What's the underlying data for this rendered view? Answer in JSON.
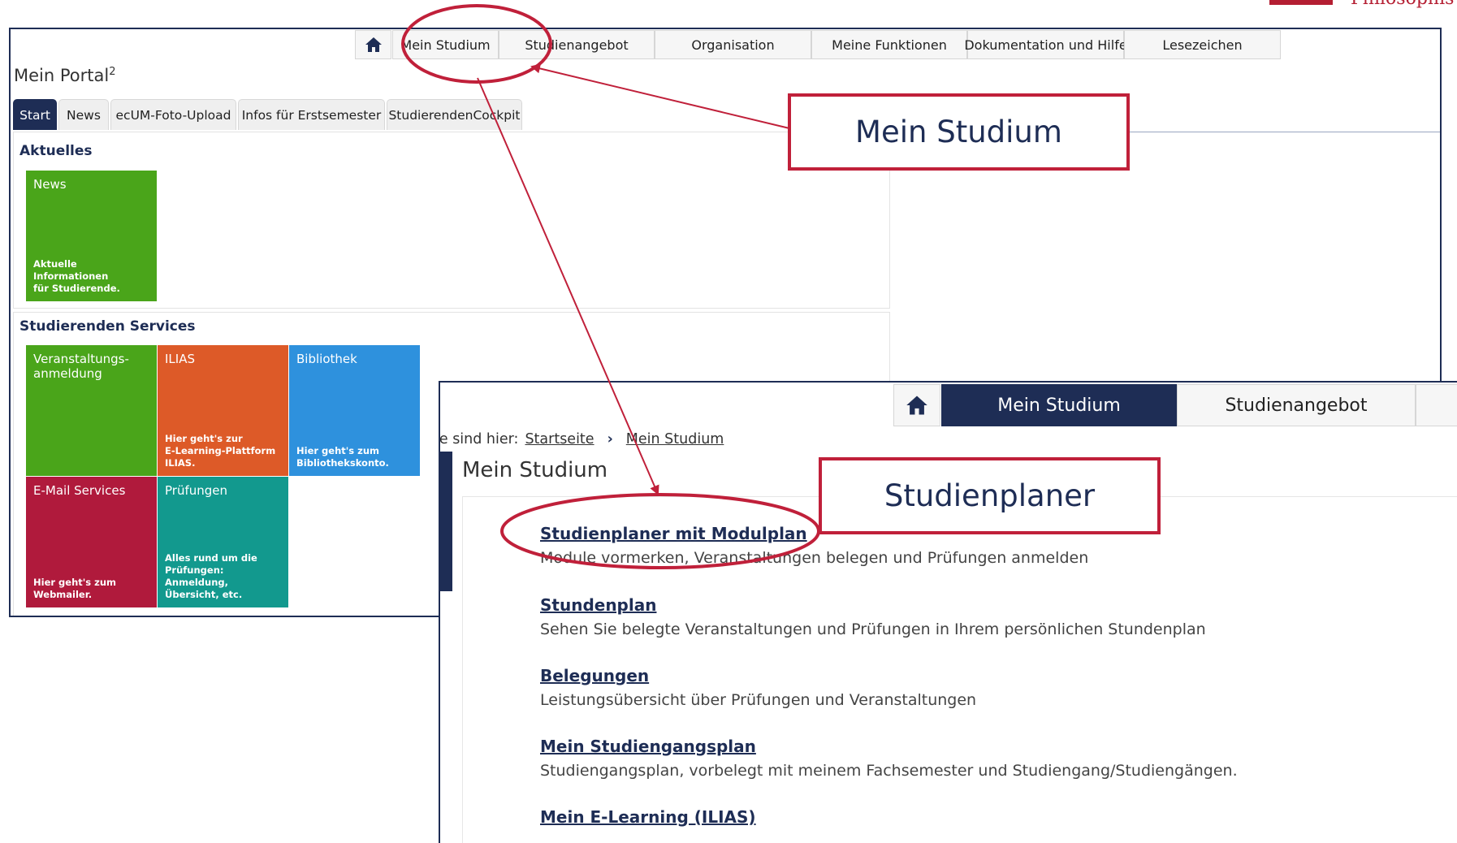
{
  "logo": {
    "fragment_text": "Philosophis",
    "color": "#b41e32"
  },
  "portal": {
    "nav": {
      "home_icon": "home-icon",
      "items": [
        "Mein Studium",
        "Studienangebot",
        "Organisation",
        "Meine Funktionen",
        "Dokumentation und Hilfe",
        "Lesezeichen"
      ]
    },
    "title": "Mein Portal",
    "title_sup": "2",
    "tabs": [
      "Start",
      "News",
      "ecUM-Foto-Upload",
      "Infos für Erstsemester",
      "StudierendenCockpit"
    ],
    "active_tab": "Start",
    "sections": {
      "aktuelles": {
        "title": "Aktuelles",
        "tiles": [
          {
            "title": "News",
            "desc": "Aktuelle Informationen\nfür Studierende.",
            "color": "#4aa51a"
          }
        ]
      },
      "services": {
        "title": "Studierenden Services",
        "tiles": [
          {
            "title": "Veranstaltungs-\nanmeldung",
            "desc": "",
            "color": "#4aa51a"
          },
          {
            "title": "ILIAS",
            "desc": "Hier geht's zur\nE-Learning-Plattform\nILIAS.",
            "color": "#dd5a28"
          },
          {
            "title": "Bibliothek",
            "desc": "Hier geht's zum\nBibliothekskonto.",
            "color": "#2e91dd"
          },
          {
            "title": "E-Mail Services",
            "desc": "Hier geht's zum\nWebmailer.",
            "color": "#b01a3c"
          },
          {
            "title": "Prüfungen",
            "desc": "Alles rund um die\nPrüfungen: Anmeldung,\nÜbersicht, etc.",
            "color": "#12998e"
          }
        ]
      }
    }
  },
  "studium": {
    "nav": {
      "home_icon": "home-icon",
      "active": "Mein Studium",
      "next": "Studienangebot"
    },
    "breadcrumb": {
      "prefix": "ie sind hier:",
      "items": [
        "Startseite",
        "Mein Studium"
      ]
    },
    "title": "Mein Studium",
    "entries": [
      {
        "title": "Studienplaner mit Modulplan",
        "desc": "Module vormerken, Veranstaltungen belegen und Prüfungen anmelden"
      },
      {
        "title": "Stundenplan",
        "desc": "Sehen Sie belegte Veranstaltungen und Prüfungen in Ihrem persönlichen Stundenplan"
      },
      {
        "title": "Belegungen",
        "desc": "Leistungsübersicht über Prüfungen und Veranstaltungen"
      },
      {
        "title": "Mein Studiengangsplan",
        "desc": "Studiengangsplan, vorbelegt mit meinem Fachsemester und Studiengang/Studiengängen."
      },
      {
        "title": "Mein E-Learning (ILIAS)",
        "desc": ""
      }
    ]
  },
  "callouts": {
    "mein_studium": "Mein Studium",
    "studienplaner": "Studienplaner"
  },
  "colors": {
    "navy": "#1e2d55",
    "annotation_red": "#c0203a"
  }
}
